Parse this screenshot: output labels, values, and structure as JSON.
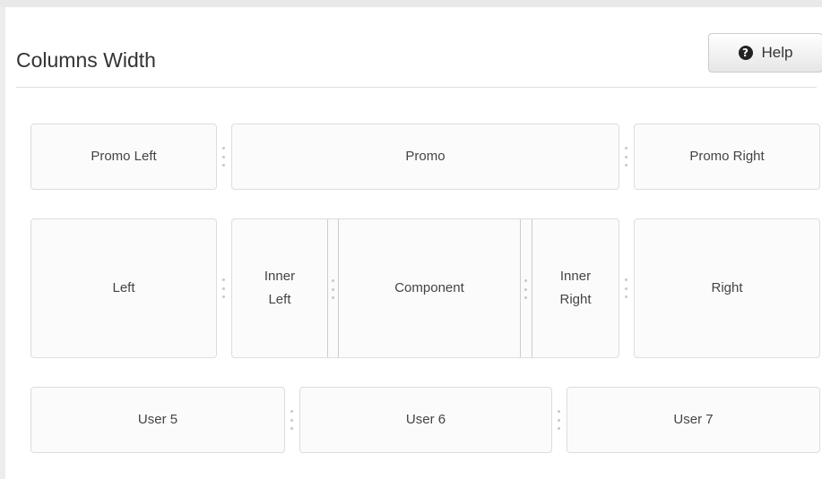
{
  "header": {
    "title": "Columns Width",
    "help_label": "Help",
    "help_icon": "question-circle-icon"
  },
  "rows": {
    "promo": {
      "left": "Promo Left",
      "center": "Promo",
      "right": "Promo Right"
    },
    "main": {
      "left": "Left",
      "inner_left_line1": "Inner",
      "inner_left_line2": "Left",
      "component": "Component",
      "inner_right_line1": "Inner",
      "inner_right_line2": "Right",
      "right": "Right"
    },
    "user": {
      "user5": "User 5",
      "user6": "User 6",
      "user7": "User 7"
    }
  }
}
